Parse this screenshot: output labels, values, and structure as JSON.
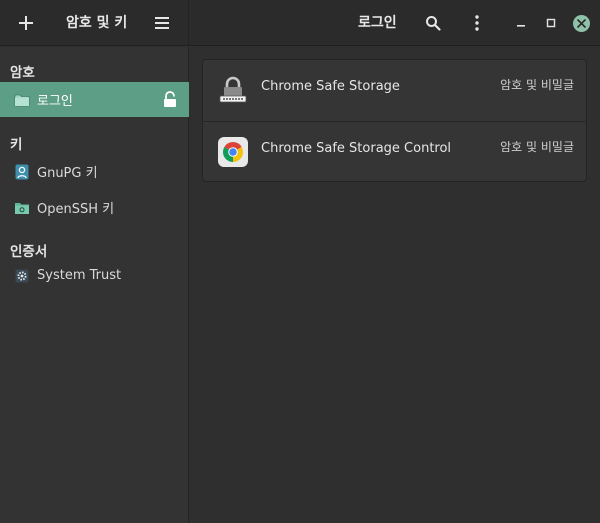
{
  "header": {
    "app_title": "암호 및 키",
    "view_title": "로그인",
    "icons": {
      "add": "plus-icon",
      "menu": "hamburger-menu-icon",
      "search": "search-icon",
      "more": "kebab-menu-icon",
      "minimize": "minimize-icon",
      "maximize": "maximize-icon",
      "close": "close-icon"
    }
  },
  "sidebar": {
    "sections": [
      {
        "title": "암호",
        "items": [
          {
            "label": "로그인",
            "icon": "folder-icon",
            "selected": true,
            "trailing_icon": "unlocked-padlock-icon"
          }
        ]
      },
      {
        "title": "키",
        "items": [
          {
            "label": "GnuPG 키",
            "icon": "gpg-key-icon"
          },
          {
            "label": "OpenSSH 키",
            "icon": "ssh-folder-icon"
          }
        ]
      },
      {
        "title": "인증서",
        "items": [
          {
            "label": "System Trust",
            "icon": "certificate-gear-icon"
          }
        ]
      }
    ]
  },
  "items": [
    {
      "name": "Chrome Safe Storage",
      "type": "암호 및 비밀글",
      "icon": "password-lock-icon"
    },
    {
      "name": "Chrome Safe Storage Control",
      "type": "암호 및 비밀글",
      "icon": "chrome-icon"
    }
  ],
  "colors": {
    "accent": "#5d9f86",
    "close_button": "#8fc1a9",
    "background": "#2f2f2f"
  }
}
